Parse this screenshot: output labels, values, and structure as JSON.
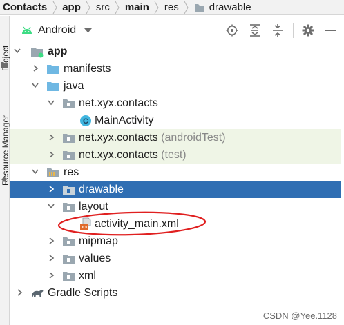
{
  "breadcrumb": {
    "items": [
      {
        "label": "Contacts",
        "bold": true
      },
      {
        "label": "app",
        "bold": true
      },
      {
        "label": "src",
        "bold": false
      },
      {
        "label": "main",
        "bold": true
      },
      {
        "label": "res",
        "bold": false
      },
      {
        "label": "drawable",
        "bold": false,
        "folder": true
      }
    ]
  },
  "side_strip": {
    "project_label": "Project",
    "resource_manager_label": "Resource Manager"
  },
  "toolbar": {
    "view_label": "Android",
    "actions": [
      "locate-icon",
      "expand-all-icon",
      "collapse-all-icon",
      "gear-icon",
      "hide-icon"
    ]
  },
  "tree": {
    "app": "app",
    "manifests": "manifests",
    "java": "java",
    "package_main": "net.xyx.contacts",
    "main_activity": "MainActivity",
    "package_android_test": "net.xyx.contacts",
    "android_test_suffix": "(androidTest)",
    "package_test": "net.xyx.contacts",
    "test_suffix": "(test)",
    "res": "res",
    "drawable": "drawable",
    "layout": "layout",
    "activity_main": "activity_main.xml",
    "mipmap": "mipmap",
    "values": "values",
    "xml": "xml",
    "gradle_scripts": "Gradle Scripts",
    "class_badge": "C",
    "xml_badge": "<>"
  },
  "colors": {
    "selection": "#2f6eb3",
    "test_background": "#eff5e6",
    "annotation": "#e02020",
    "android_green": "#3ddc84",
    "folder_blue": "#6fb8e3"
  },
  "watermark": "CSDN @Yee.1128"
}
